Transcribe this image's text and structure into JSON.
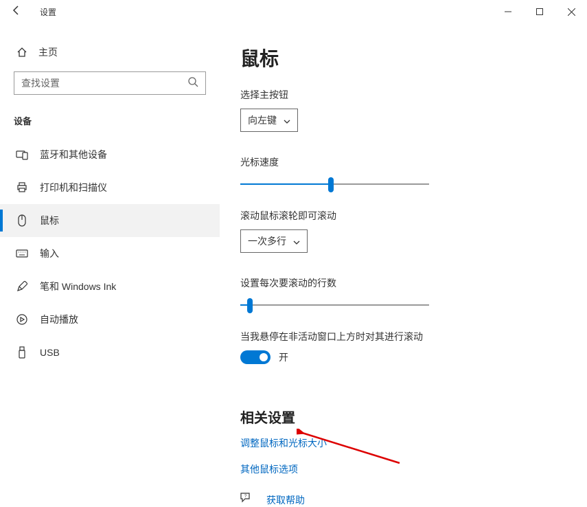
{
  "window": {
    "title": "设置"
  },
  "sidebar": {
    "home": "主页",
    "search_placeholder": "查找设置",
    "category": "设备",
    "items": [
      {
        "label": "蓝牙和其他设备"
      },
      {
        "label": "打印机和扫描仪"
      },
      {
        "label": "鼠标"
      },
      {
        "label": "输入"
      },
      {
        "label": "笔和 Windows Ink"
      },
      {
        "label": "自动播放"
      },
      {
        "label": "USB"
      }
    ]
  },
  "main": {
    "title": "鼠标",
    "primary_button_label": "选择主按钮",
    "primary_button_value": "向左键",
    "cursor_speed_label": "光标速度",
    "cursor_speed_percent": 48,
    "scroll_wheel_label": "滚动鼠标滚轮即可滚动",
    "scroll_wheel_value": "一次多行",
    "lines_label": "设置每次要滚动的行数",
    "lines_percent": 5,
    "inactive_scroll_label": "当我悬停在非活动窗口上方时对其进行滚动",
    "toggle_on_text": "开",
    "related_heading": "相关设置",
    "link_cursor_size": "调整鼠标和光标大小",
    "link_other_options": "其他鼠标选项",
    "help_label": "获取帮助"
  }
}
